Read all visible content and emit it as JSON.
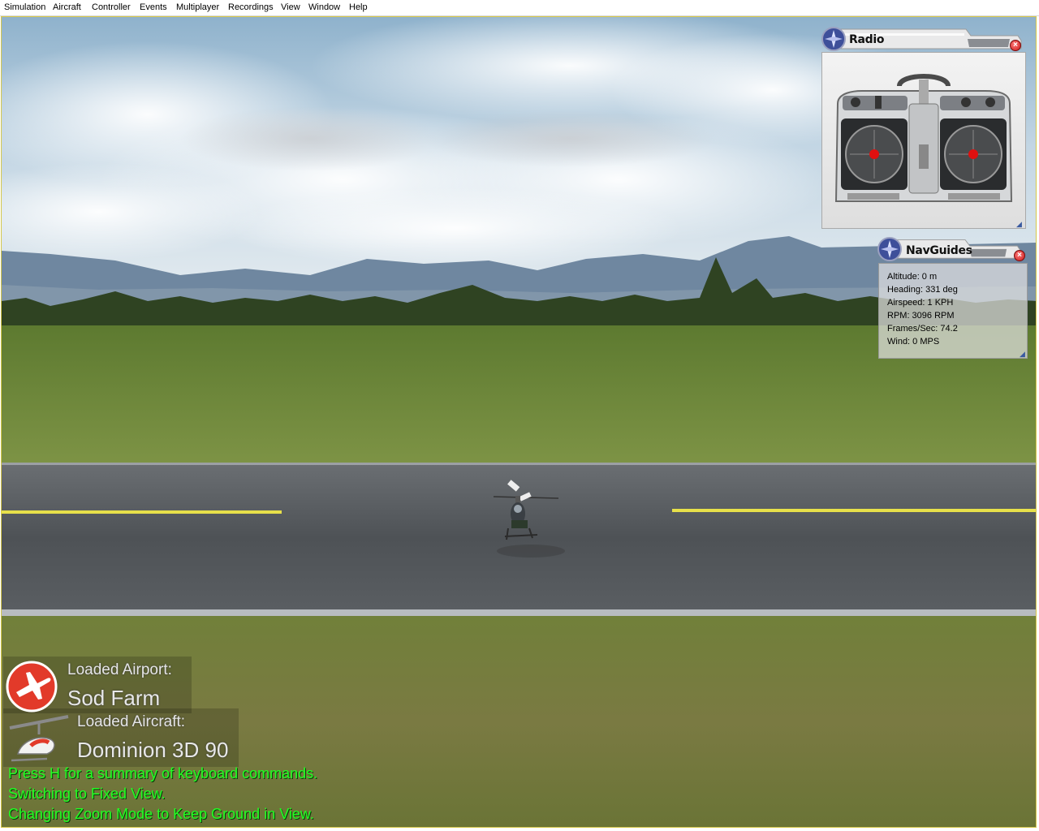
{
  "menu": [
    "Simulation",
    "Aircraft",
    "Controller",
    "Events",
    "Multiplayer",
    "Recordings",
    "View",
    "Window",
    "Help"
  ],
  "colors": {
    "sky": "#c6d8e6",
    "grass": "#6f8a3c",
    "runway": "#55595d",
    "runway_line": "#e7e04a",
    "status_text": "#22ff22",
    "accent_red": "#e23a2a"
  },
  "radio_panel": {
    "title": "Radio",
    "icon": "compass-icon",
    "close_icon": "close-icon",
    "left_stick": "center",
    "right_stick": "center"
  },
  "nav_panel": {
    "title": "NavGuides",
    "icon": "compass-icon",
    "lines": [
      "Altitude: 0 m",
      "Heading: 331 deg",
      "Airspeed: 1 KPH",
      "RPM: 3096 RPM",
      "Frames/Sec: 74.2",
      "Wind: 0 MPS"
    ]
  },
  "info": {
    "airport_label": "Loaded Airport:",
    "airport_name": "Sod Farm",
    "airport_icon": "airplane-icon",
    "aircraft_label": "Loaded Aircraft:",
    "aircraft_name": "Dominion 3D 90",
    "aircraft_icon": "helicopter-icon"
  },
  "status_messages": [
    "Press H for a summary of keyboard commands.",
    "Switching to Fixed View.",
    "Changing Zoom Mode to Keep Ground in View."
  ]
}
